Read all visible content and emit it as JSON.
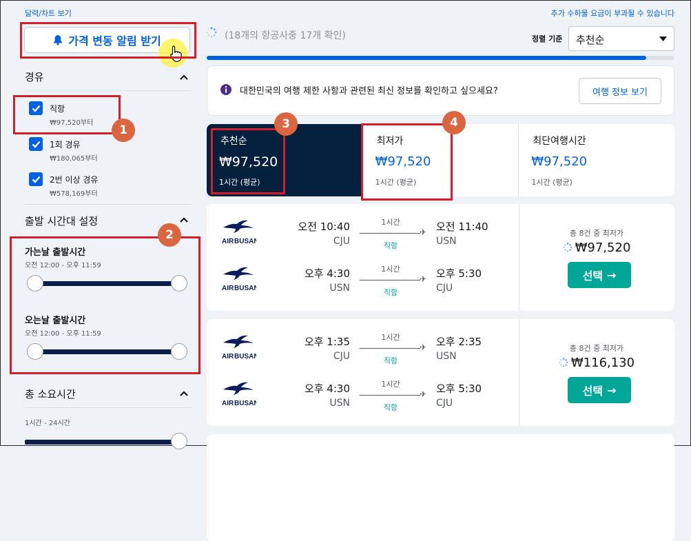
{
  "top_left_link": "달력/차트 보기",
  "top_right_link": "추가 수하물 요금이 부과될 수 있습니다",
  "alert_button": {
    "label": "가격 변동 알림 받기"
  },
  "loading_text": "(18개의 항공사중 17개 확인)",
  "progress": {
    "fraction": 0.94
  },
  "sort": {
    "label": "정렬 기준",
    "value": "추천순"
  },
  "filters": {
    "stops": {
      "title": "경유",
      "options": [
        {
          "label": "직항",
          "price": "₩97,520부터",
          "checked": true
        },
        {
          "label": "1회 경유",
          "price": "₩180,065부터",
          "checked": true
        },
        {
          "label": "2번 이상 경유",
          "price": "₩578,169부터",
          "checked": true
        }
      ]
    },
    "departure_time": {
      "title": "출발 시간대 설정",
      "outbound": {
        "title": "가는날 출발시간",
        "range": "오전 12:00 - 오후 11:59"
      },
      "inbound": {
        "title": "오는날 출발시간",
        "range": "오전 12:00 - 오후 11:59"
      }
    },
    "duration": {
      "title": "총 소요시간",
      "range": "1시간 - 24시간"
    }
  },
  "info_banner": {
    "text": "대한민국의 여행 제한 사항과 관련된 최신 정보를 확인하고 싶으세요?",
    "button": "여행 정보 보기"
  },
  "sort_tabs": [
    {
      "label": "추천순",
      "price": "₩97,520",
      "sub": "1시간 (평균)",
      "active": true
    },
    {
      "label": "최저가",
      "price": "₩97,520",
      "sub": "1시간 (평균)",
      "active": false
    },
    {
      "label": "최단여행시간",
      "price": "₩97,520",
      "sub": "1시간 (평균)",
      "active": false
    }
  ],
  "results": [
    {
      "legs": [
        {
          "airline": "AIR BUSAN",
          "dep_time": "오전 10:40",
          "dep_code": "CJU",
          "duration": "1시간",
          "stops": "직항",
          "arr_time": "오전 11:40",
          "arr_code": "USN"
        },
        {
          "airline": "AIR BUSAN",
          "dep_time": "오후 4:30",
          "dep_code": "USN",
          "duration": "1시간",
          "stops": "직항",
          "arr_time": "오후 5:30",
          "arr_code": "CJU"
        }
      ],
      "price_note": "총 8건 중 최저가",
      "price": "₩97,520",
      "select_label": "선택"
    },
    {
      "legs": [
        {
          "airline": "AIR BUSAN",
          "dep_time": "오후 1:35",
          "dep_code": "CJU",
          "duration": "1시간",
          "stops": "직항",
          "arr_time": "오후 2:35",
          "arr_code": "USN"
        },
        {
          "airline": "AIR BUSAN",
          "dep_time": "오후 4:30",
          "dep_code": "USN",
          "duration": "1시간",
          "stops": "직항",
          "arr_time": "오후 5:30",
          "arr_code": "CJU"
        }
      ],
      "price_note": "총 8건 중 최저가",
      "price": "₩116,130",
      "select_label": "선택"
    }
  ],
  "annotations": [
    "1",
    "2",
    "3",
    "4"
  ],
  "colors": {
    "accent": "#0062e3",
    "select": "#00a698",
    "dark_tab": "#05203c",
    "highlight": "#d11f2b",
    "badge": "#d9663f"
  }
}
